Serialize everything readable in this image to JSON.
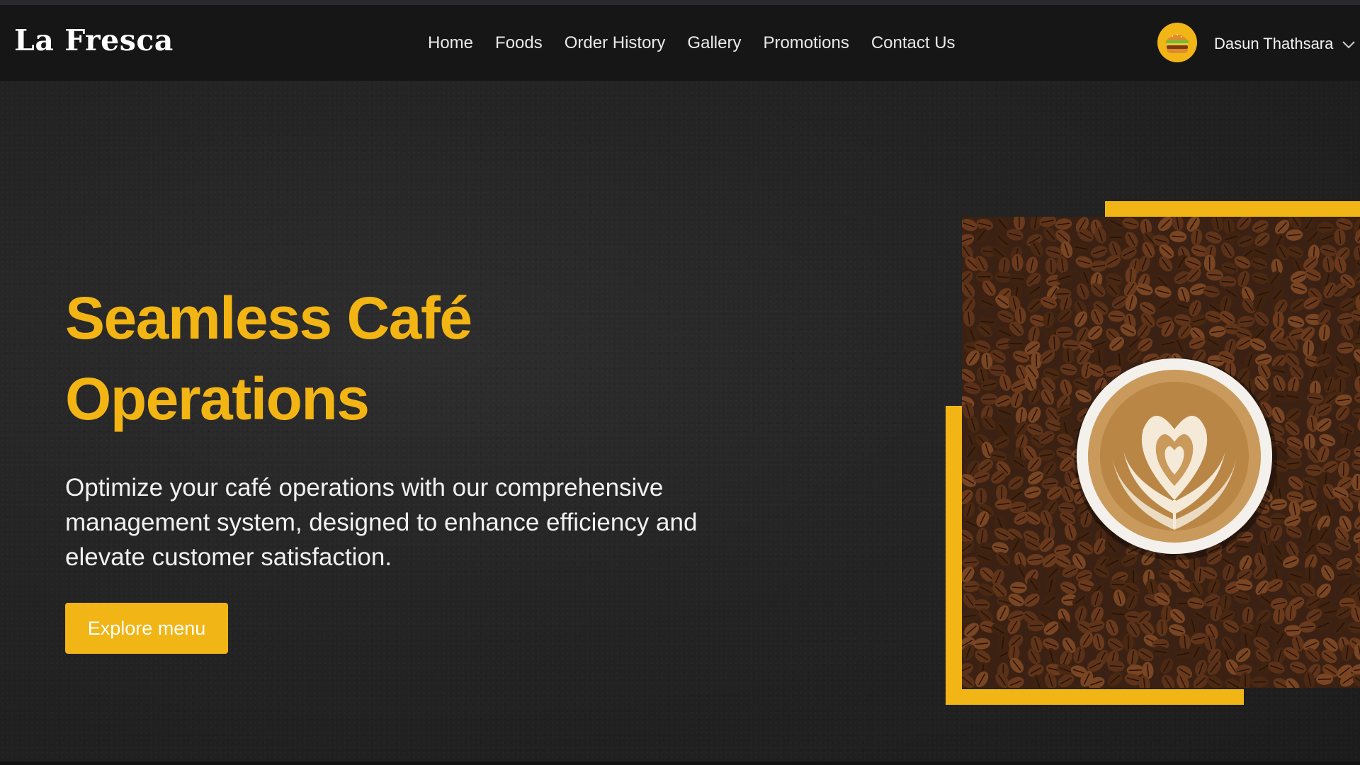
{
  "brand": {
    "name": "La Fresca"
  },
  "nav": {
    "links": [
      {
        "label": "Home"
      },
      {
        "label": "Foods"
      },
      {
        "label": "Order History"
      },
      {
        "label": "Gallery"
      },
      {
        "label": "Promotions"
      },
      {
        "label": "Contact Us"
      }
    ]
  },
  "user": {
    "name": "Dasun Thathsara",
    "avatar_icon": "burger-icon",
    "menu_icon": "chevron-down-icon"
  },
  "hero": {
    "headline_line1": "Seamless Café",
    "headline_line2": "Operations",
    "description": "Optimize your café operations with our comprehensive management system, designed to enhance efficiency and elevate customer satisfaction.",
    "cta_label": "Explore menu",
    "image_icon": "coffee-latte-on-beans-image"
  },
  "colors": {
    "accent": "#f1b516",
    "background": "#242424",
    "navbar": "#161616",
    "text": "#f1f1f1"
  }
}
